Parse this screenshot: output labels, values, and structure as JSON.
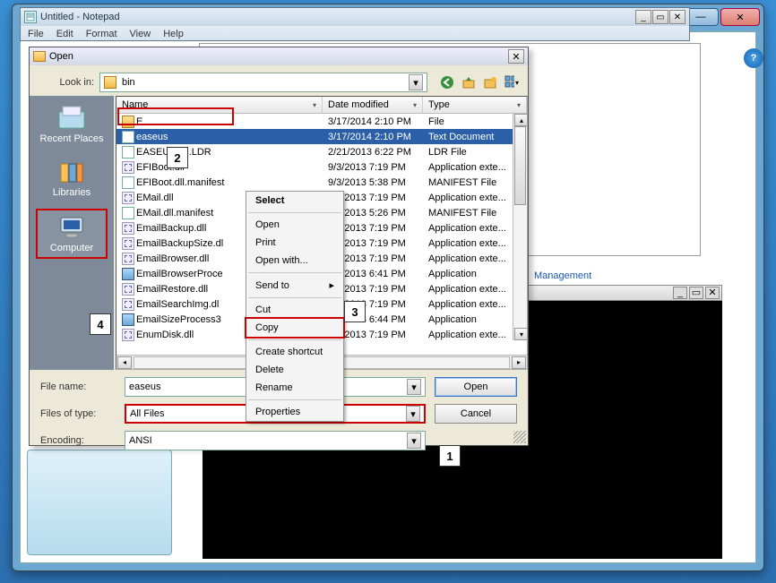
{
  "outer_window": {
    "minimize_glyph": "—",
    "close_glyph": "✕"
  },
  "help_button": "?",
  "management_link": "Management",
  "notepad": {
    "title": "Untitled - Notepad",
    "menu": [
      "File",
      "Edit",
      "Format",
      "View",
      "Help"
    ],
    "min_glyph": "_",
    "max_glyph": "▭",
    "close_glyph": "✕"
  },
  "open_dialog": {
    "title": "Open",
    "look_in_label": "Look in:",
    "look_in_value": "bin",
    "columns": {
      "name": "Name",
      "date": "Date modified",
      "type": "Type"
    },
    "places": [
      {
        "key": "recent",
        "label": "Recent Places"
      },
      {
        "key": "libraries",
        "label": "Libraries"
      },
      {
        "key": "computer",
        "label": "Computer"
      }
    ],
    "rows": [
      {
        "icon": "fldr",
        "name": "E",
        "date": "3/17/2014 2:10 PM",
        "type": "File"
      },
      {
        "icon": "doc",
        "name": "easeus",
        "date": "3/17/2014 2:10 PM",
        "type": "Text Document",
        "selected": true
      },
      {
        "icon": "doc",
        "name": "EASEUSLD.LDR",
        "date": "2/21/2013 6:22 PM",
        "type": "LDR File"
      },
      {
        "icon": "dll",
        "name": "EFIBoot.dll",
        "date": "9/3/2013 7:19 PM",
        "type": "Application exte..."
      },
      {
        "icon": "doc",
        "name": "EFIBoot.dll.manifest",
        "date": "9/3/2013 5:38 PM",
        "type": "MANIFEST File"
      },
      {
        "icon": "dll",
        "name": "EMail.dll",
        "date": "9/3/2013 7:19 PM",
        "type": "Application exte..."
      },
      {
        "icon": "doc",
        "name": "EMail.dll.manifest",
        "date": "9/3/2013 5:26 PM",
        "type": "MANIFEST File"
      },
      {
        "icon": "dll",
        "name": "EmailBackup.dll",
        "date": "9/3/2013 7:19 PM",
        "type": "Application exte..."
      },
      {
        "icon": "dll",
        "name": "EmailBackupSize.dl",
        "date": "9/3/2013 7:19 PM",
        "type": "Application exte..."
      },
      {
        "icon": "dll",
        "name": "EmailBrowser.dll",
        "date": "9/3/2013 7:19 PM",
        "type": "Application exte..."
      },
      {
        "icon": "app",
        "name": "EmailBrowserProce",
        "date": "9/3/2013 6:41 PM",
        "type": "Application"
      },
      {
        "icon": "dll",
        "name": "EmailRestore.dll",
        "date": "9/3/2013 7:19 PM",
        "type": "Application exte..."
      },
      {
        "icon": "dll",
        "name": "EmailSearchImg.dl",
        "date": "9/3/2013 7:19 PM",
        "type": "Application exte..."
      },
      {
        "icon": "app",
        "name": "EmailSizeProcess3",
        "date": "9/3/2013 6:44 PM",
        "type": "Application"
      },
      {
        "icon": "dll",
        "name": "EnumDisk.dll",
        "date": "9/3/2013 7:19 PM",
        "type": "Application exte..."
      }
    ],
    "file_name_label": "File name:",
    "file_name_value": "easeus",
    "files_type_label": "Files of type:",
    "files_type_value": "All Files",
    "encoding_label": "Encoding:",
    "encoding_value": "ANSI",
    "open_btn": "Open",
    "cancel_btn": "Cancel"
  },
  "context_menu": {
    "select": "Select",
    "open": "Open",
    "print": "Print",
    "open_with": "Open with...",
    "send_to": "Send to",
    "cut": "Cut",
    "copy": "Copy",
    "create_shortcut": "Create shortcut",
    "delete": "Delete",
    "rename": "Rename",
    "properties": "Properties"
  },
  "callouts": {
    "c1": "1",
    "c2": "2",
    "c3": "3",
    "c4": "4"
  },
  "placeholders": {
    "placeholder_dot": "."
  }
}
